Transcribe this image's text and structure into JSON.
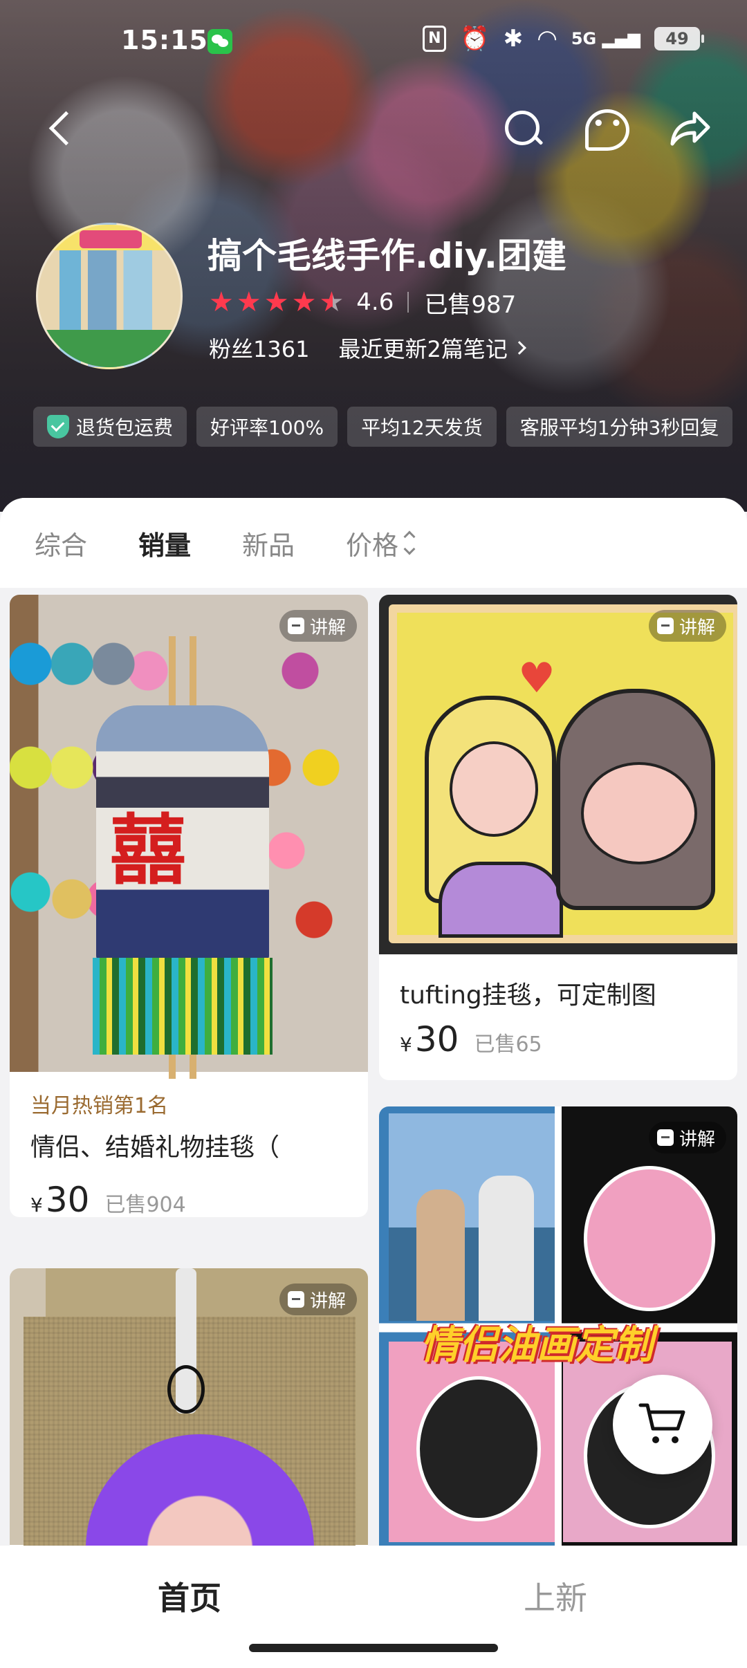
{
  "status_bar": {
    "time": "15:15",
    "network": "5G",
    "battery": "49"
  },
  "shop": {
    "name": "搞个毛线手作.diy.团建",
    "rating": "4.6",
    "rating_value": 4.6,
    "sold": "已售987",
    "fans": "粉丝1361",
    "notes_link": "最近更新2篇笔记"
  },
  "service_tags": [
    {
      "label": "退货包运费",
      "icon": "shield-check-icon"
    },
    {
      "label": "好评率100%"
    },
    {
      "label": "平均12天发货"
    },
    {
      "label": "客服平均1分钟3秒回复"
    }
  ],
  "sort_tabs": [
    {
      "label": "综合",
      "active": false
    },
    {
      "label": "销量",
      "active": true
    },
    {
      "label": "新品",
      "active": false
    },
    {
      "label": "价格",
      "active": false
    }
  ],
  "products": [
    {
      "badge": "讲解",
      "hot_tag": "当月热销第1名",
      "title": "情侣、结婚礼物挂毯（",
      "currency": "¥",
      "price": "30",
      "sold": "已售904"
    },
    {
      "badge": "讲解",
      "title": "tufting挂毯，可定制图",
      "currency": "¥",
      "price": "30",
      "sold": "已售65"
    },
    {
      "badge": "讲解",
      "image_text": "情侣油画定制"
    },
    {
      "badge": "讲解"
    }
  ],
  "bottom_nav": [
    {
      "label": "首页",
      "active": true
    },
    {
      "label": "上新",
      "active": false
    }
  ],
  "colors": {
    "star": "#ff3a4e",
    "hot_tag": "#9a6a30",
    "active_text": "#222222",
    "inactive_text": "#999999"
  }
}
